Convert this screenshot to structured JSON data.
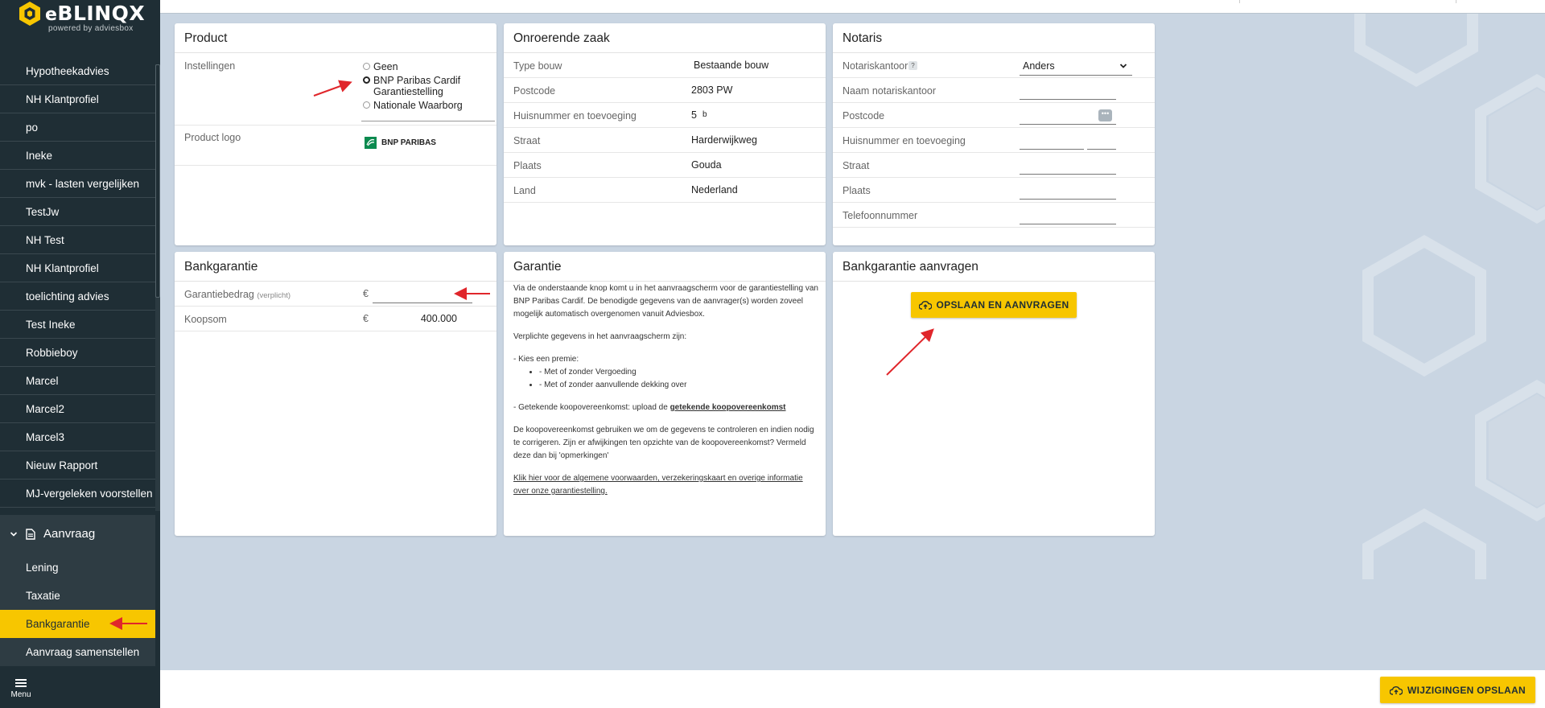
{
  "app": {
    "logo_text": "BLINQX",
    "logo_prefix": "e",
    "logo_sub": "powered by adviesbox"
  },
  "sidebar": {
    "items": [
      {
        "label": "Hypotheekadvies"
      },
      {
        "label": "NH Klantprofiel"
      },
      {
        "label": "po"
      },
      {
        "label": "Ineke"
      },
      {
        "label": "mvk - lasten vergelijken"
      },
      {
        "label": "TestJw"
      },
      {
        "label": "NH Test"
      },
      {
        "label": "NH Klantprofiel"
      },
      {
        "label": "toelichting advies"
      },
      {
        "label": "Test Ineke"
      },
      {
        "label": "Robbieboy"
      },
      {
        "label": "Marcel"
      },
      {
        "label": "Marcel2"
      },
      {
        "label": "Marcel3"
      },
      {
        "label": "Nieuw Rapport"
      },
      {
        "label": "MJ-vergeleken voorstellen"
      }
    ],
    "section": {
      "label": "Aanvraag",
      "items": [
        {
          "label": "Lening"
        },
        {
          "label": "Taxatie"
        },
        {
          "label": "Bankgarantie",
          "active": true
        },
        {
          "label": "Aanvraag samenstellen"
        }
      ]
    },
    "menu_label": "Menu"
  },
  "product": {
    "title": "Product",
    "instellingen_label": "Instellingen",
    "options": [
      "Geen",
      "BNP Paribas Cardif Garantiestelling",
      "Nationale Waarborg"
    ],
    "selected_index": 1,
    "logo_label": "Product logo",
    "logo_text": "BNP PARIBAS"
  },
  "onroerende_zaak": {
    "title": "Onroerende zaak",
    "rows": [
      {
        "label": "Type bouw",
        "value": "Bestaande bouw"
      },
      {
        "label": "Postcode",
        "value": "2803 PW"
      },
      {
        "label": "Huisnummer en toevoeging",
        "value": "5",
        "suffix": "b"
      },
      {
        "label": "Straat",
        "value": "Harderwijkweg"
      },
      {
        "label": "Plaats",
        "value": "Gouda"
      },
      {
        "label": "Land",
        "value": "Nederland"
      }
    ]
  },
  "notaris": {
    "title": "Notaris",
    "rows": [
      {
        "label": "Notariskantoor",
        "value": "Anders"
      },
      {
        "label": "Naam notariskantoor",
        "value": ""
      },
      {
        "label": "Postcode",
        "value": ""
      },
      {
        "label": "Huisnummer en toevoeging",
        "value": ""
      },
      {
        "label": "Straat",
        "value": ""
      },
      {
        "label": "Plaats",
        "value": ""
      },
      {
        "label": "Telefoonnummer",
        "value": ""
      }
    ],
    "help_badge": "?"
  },
  "bankgarantie": {
    "title": "Bankgarantie",
    "garantiebedrag_label": "Garantiebedrag",
    "verplicht": "(verplicht)",
    "currency": "€",
    "garantiebedrag_value": "",
    "koopsom_label": "Koopsom",
    "koopsom_value": "400.000"
  },
  "garantie": {
    "title": "Garantie",
    "p1": "Via de onderstaande knop komt u in het aanvraagscherm voor de garantiestelling van BNP Paribas Cardif. De benodigde gegevens van de aanvrager(s) worden zoveel mogelijk automatisch overgenomen vanuit Adviesbox.",
    "p2": "Verplichte gegevens in het aanvraagscherm zijn:",
    "p3": "- Kies een premie:",
    "li1": "- Met of zonder Vergoeding",
    "li2": "- Met of zonder aanvullende dekking over",
    "p4_prefix": "- Getekende koopovereenkomst: upload de ",
    "p4_link": "getekende koopovereenkomst",
    "p5": "De koopovereenkomst gebruiken we om de gegevens te controleren en indien nodig te corrigeren. Zijn er afwijkingen ten opzichte van de koopovereenkomst? Vermeld deze dan bij 'opmerkingen'",
    "p6_link": "Klik hier voor de algemene voorwaarden, verzekeringskaart en overige informatie over onze garantiestelling."
  },
  "aanvragen": {
    "title": "Bankgarantie aanvragen",
    "button_label": "OPSLAAN EN AANVRAGEN"
  },
  "footer": {
    "save_label": "WIJZIGINGEN OPSLAAN"
  },
  "colors": {
    "accent": "#f7c600",
    "sidebar": "#1f2e35",
    "background": "#c9d5e2",
    "arrow": "#e0262b"
  }
}
